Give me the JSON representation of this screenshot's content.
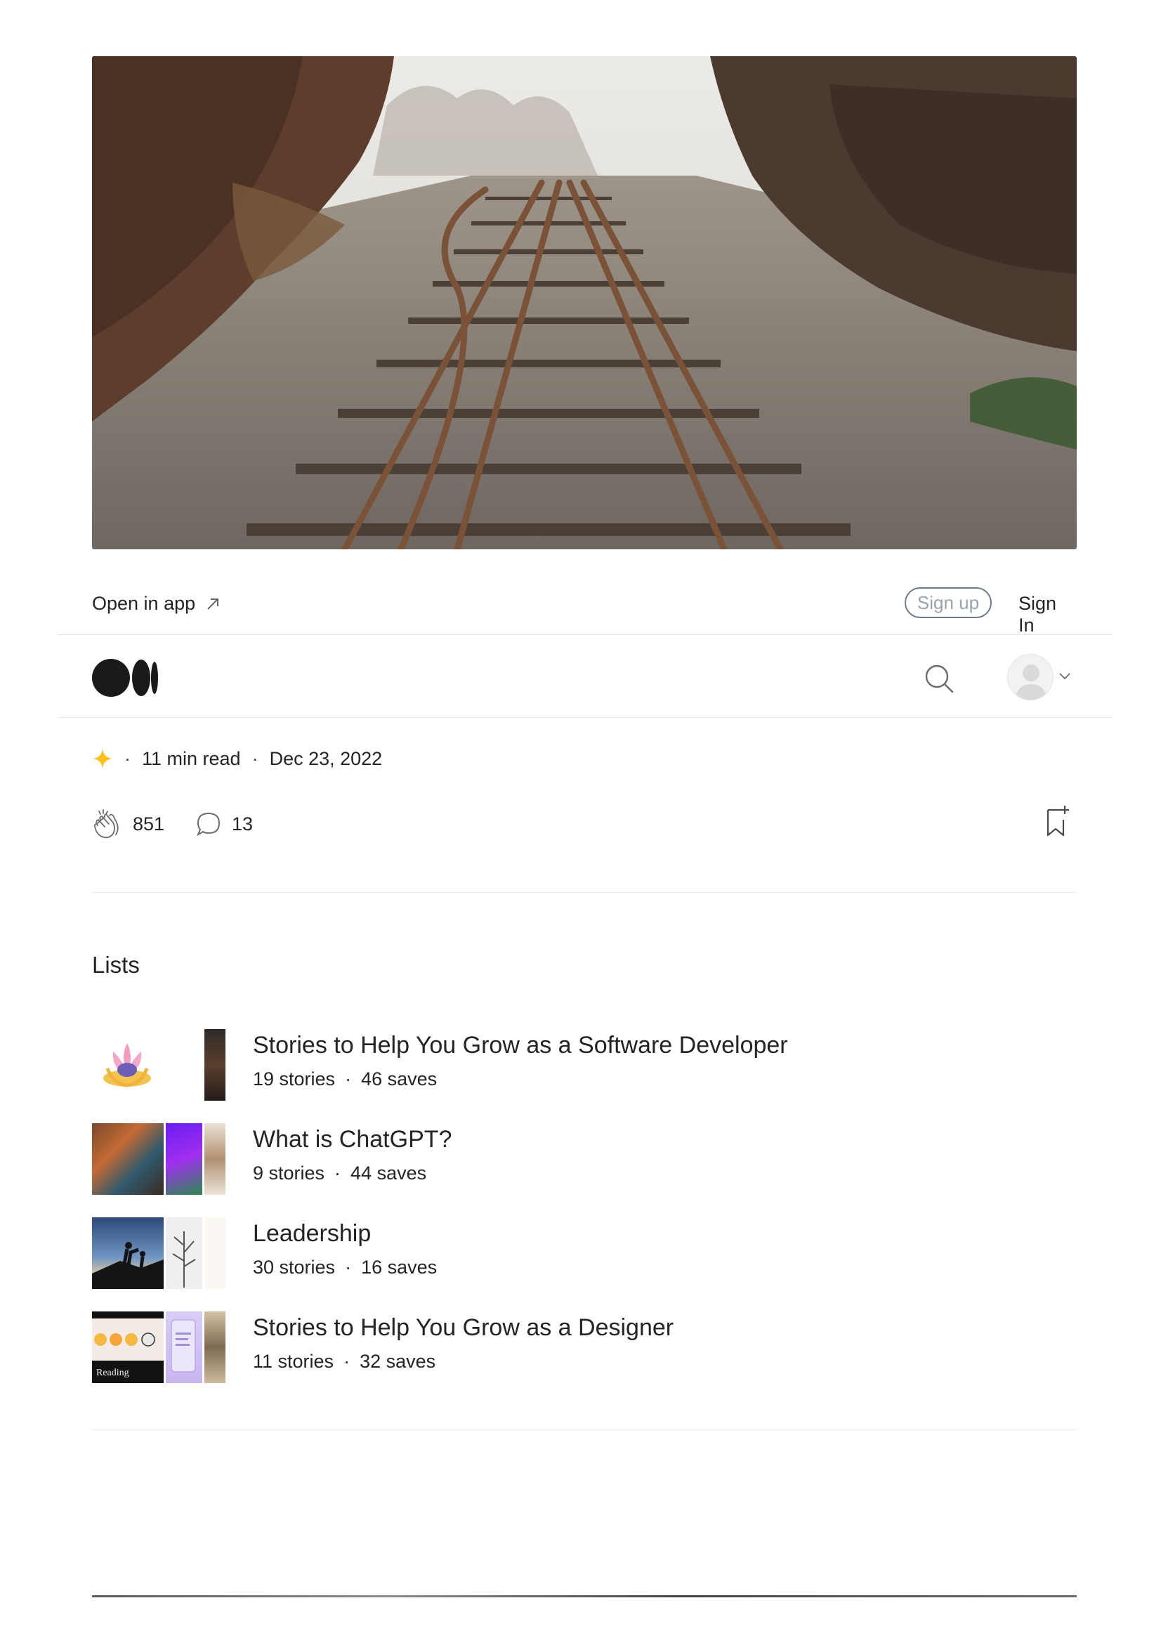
{
  "hero": {
    "image_name": "railway-tracks-photo"
  },
  "topbar": {
    "open_in_app": "Open in app",
    "sign_up": "Sign up",
    "sign_in": "Sign In"
  },
  "article_meta": {
    "read_time": "11 min read",
    "date": "Dec 23, 2022",
    "separator": "·"
  },
  "actions": {
    "claps": "851",
    "comments": "13"
  },
  "lists": {
    "heading": "Lists",
    "items": [
      {
        "title": "Stories to Help You Grow as a Software Developer",
        "stories": "19 stories",
        "saves": "46 saves"
      },
      {
        "title": "What is ChatGPT?",
        "stories": "9 stories",
        "saves": "44 saves"
      },
      {
        "title": "Leadership",
        "stories": "30 stories",
        "saves": "16 saves"
      },
      {
        "title": "Stories to Help You Grow as a Designer",
        "stories": "11 stories",
        "saves": "32 saves"
      }
    ],
    "thumb_text_reading": "Reading"
  },
  "colors": {
    "text": "#242424",
    "divider": "#e6e6e6",
    "signup_border": "#6b7a89",
    "star": "#ffc017"
  }
}
